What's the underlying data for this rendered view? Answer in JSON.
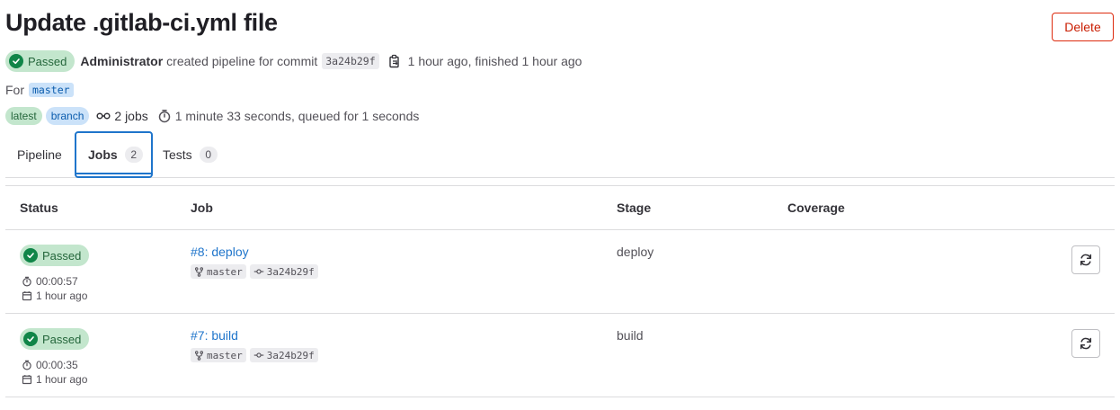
{
  "header": {
    "title": "Update .gitlab-ci.yml file",
    "delete_label": "Delete"
  },
  "summary": {
    "status_label": "Passed",
    "author": "Administrator",
    "action_text": "created pipeline for commit",
    "commit_sha": "3a24b29f",
    "time_text": "1 hour ago, finished 1 hour ago",
    "for_label": "For",
    "ref": "master",
    "tags": [
      "latest",
      "branch"
    ],
    "jobs_count": "2 jobs",
    "duration_text": "1 minute 33 seconds, queued for 1 seconds"
  },
  "tabs": [
    {
      "label": "Pipeline"
    },
    {
      "label": "Jobs",
      "count": "2"
    },
    {
      "label": "Tests",
      "count": "0"
    }
  ],
  "table": {
    "headers": {
      "status": "Status",
      "job": "Job",
      "stage": "Stage",
      "coverage": "Coverage"
    },
    "rows": [
      {
        "status": "Passed",
        "duration": "00:00:57",
        "finished": "1 hour ago",
        "job": "#8: deploy",
        "branch": "master",
        "commit": "3a24b29f",
        "stage": "deploy"
      },
      {
        "status": "Passed",
        "duration": "00:00:35",
        "finished": "1 hour ago",
        "job": "#7: build",
        "branch": "master",
        "commit": "3a24b29f",
        "stage": "build"
      }
    ]
  },
  "colors": {
    "success_bg": "#c3e6cd",
    "success_icon": "#108548",
    "link": "#1f75cb",
    "danger": "#dd2b0e"
  }
}
